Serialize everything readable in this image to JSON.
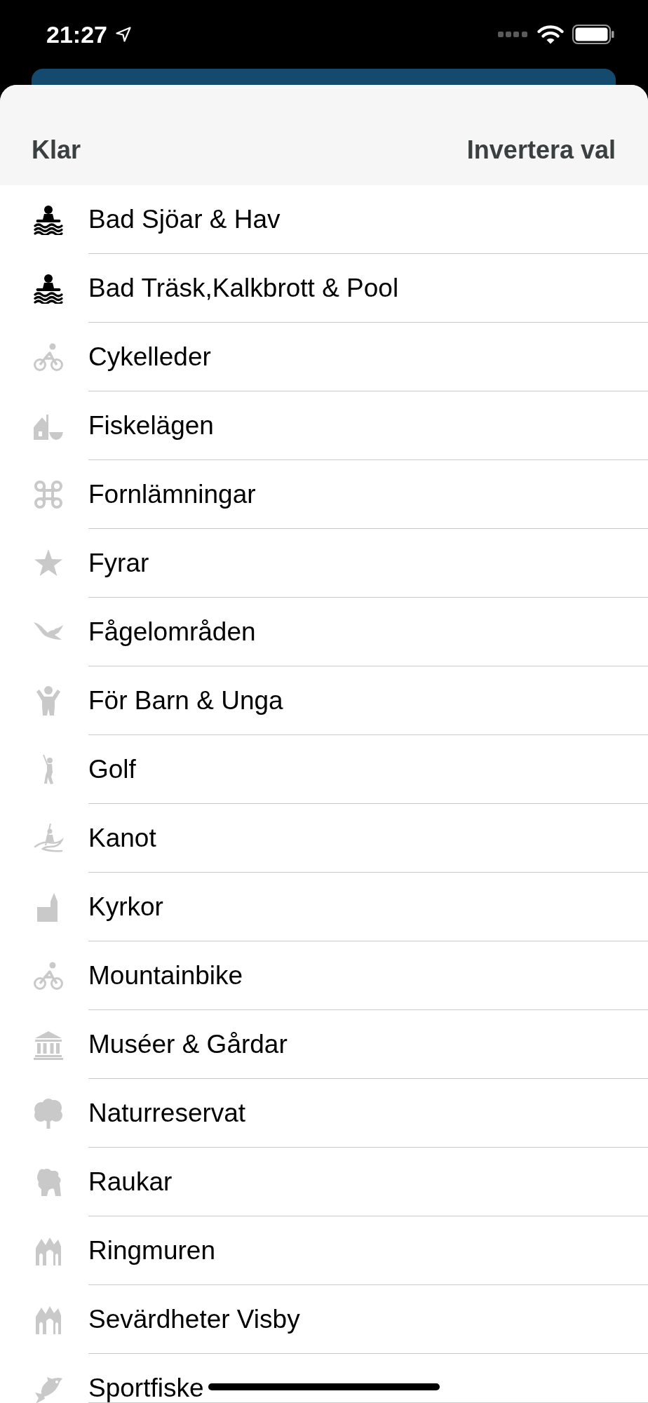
{
  "status_bar": {
    "time": "21:27"
  },
  "header": {
    "left_button": "Klar",
    "right_button": "Invertera val"
  },
  "categories": [
    {
      "label": "Bad Sjöar & Hav",
      "selected": true
    },
    {
      "label": "Bad Träsk,Kalkbrott & Pool",
      "selected": true
    },
    {
      "label": "Cykelleder",
      "selected": false
    },
    {
      "label": "Fiskelägen",
      "selected": false
    },
    {
      "label": "Fornlämningar",
      "selected": false
    },
    {
      "label": "Fyrar",
      "selected": false
    },
    {
      "label": "Fågelområden",
      "selected": false
    },
    {
      "label": "För Barn & Unga",
      "selected": false
    },
    {
      "label": "Golf",
      "selected": false
    },
    {
      "label": "Kanot",
      "selected": false
    },
    {
      "label": "Kyrkor",
      "selected": false
    },
    {
      "label": "Mountainbike",
      "selected": false
    },
    {
      "label": "Muséer & Gårdar",
      "selected": false
    },
    {
      "label": "Naturreservat",
      "selected": false
    },
    {
      "label": "Raukar",
      "selected": false
    },
    {
      "label": "Ringmuren",
      "selected": false
    },
    {
      "label": "Sevärdheter Visby",
      "selected": false
    },
    {
      "label": "Sportfiske",
      "selected": false
    }
  ]
}
